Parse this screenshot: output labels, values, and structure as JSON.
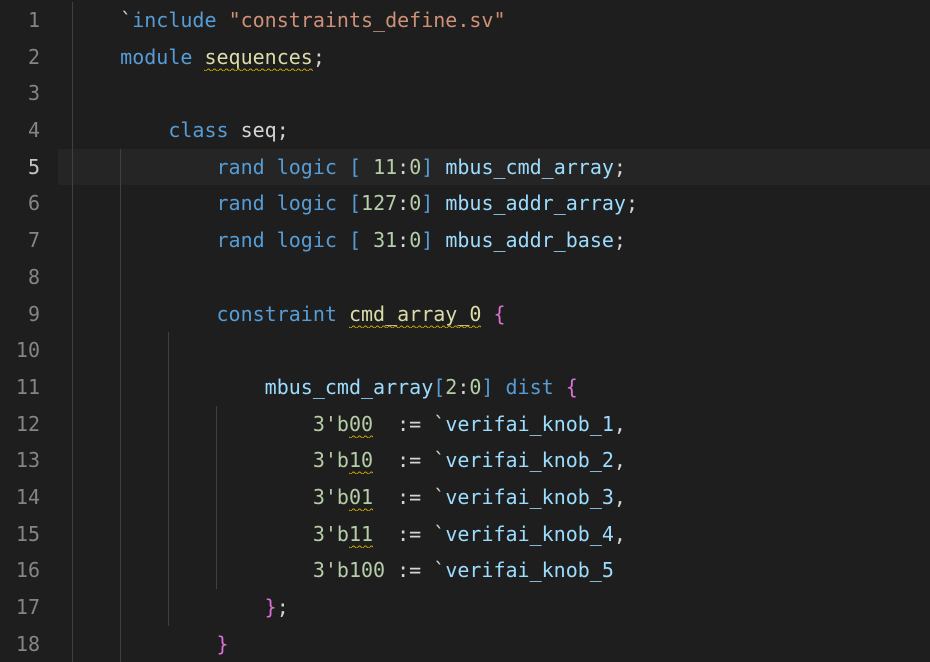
{
  "active_line": 5,
  "lines": [
    {
      "n": 1,
      "indent": 1,
      "guides": [
        1
      ],
      "tokens": [
        {
          "t": "`",
          "c": "tok-def"
        },
        {
          "t": "include",
          "c": "tok-kw"
        },
        {
          "t": " ",
          "c": ""
        },
        {
          "t": "\"constraints_define.sv\"",
          "c": "tok-str"
        }
      ]
    },
    {
      "n": 2,
      "indent": 1,
      "guides": [
        1
      ],
      "tokens": [
        {
          "t": "module",
          "c": "tok-kw"
        },
        {
          "t": " ",
          "c": ""
        },
        {
          "t": "sequences",
          "c": "tok-func squiggle"
        },
        {
          "t": ";",
          "c": "tok-punc"
        }
      ]
    },
    {
      "n": 3,
      "indent": 0,
      "guides": [
        1
      ],
      "tokens": []
    },
    {
      "n": 4,
      "indent": 2,
      "guides": [
        1
      ],
      "tokens": [
        {
          "t": "class",
          "c": "tok-kw"
        },
        {
          "t": " ",
          "c": ""
        },
        {
          "t": "seq",
          "c": "tok-def"
        },
        {
          "t": ";",
          "c": "tok-punc"
        }
      ]
    },
    {
      "n": 5,
      "indent": 3,
      "guides": [
        1,
        2
      ],
      "active": true,
      "tokens": [
        {
          "t": "rand",
          "c": "tok-kw"
        },
        {
          "t": " ",
          "c": ""
        },
        {
          "t": "logic",
          "c": "tok-type"
        },
        {
          "t": " ",
          "c": ""
        },
        {
          "t": "[",
          "c": "tok-brkt"
        },
        {
          "t": " 11",
          "c": "tok-num"
        },
        {
          "t": ":",
          "c": "tok-def"
        },
        {
          "t": "0",
          "c": "tok-num"
        },
        {
          "t": "]",
          "c": "tok-brkt"
        },
        {
          "t": " ",
          "c": ""
        },
        {
          "t": "mbus_cmd_array",
          "c": "tok-var"
        },
        {
          "t": ";",
          "c": "tok-punc"
        }
      ]
    },
    {
      "n": 6,
      "indent": 3,
      "guides": [
        1,
        2
      ],
      "tokens": [
        {
          "t": "rand",
          "c": "tok-kw"
        },
        {
          "t": " ",
          "c": ""
        },
        {
          "t": "logic",
          "c": "tok-type"
        },
        {
          "t": " ",
          "c": ""
        },
        {
          "t": "[",
          "c": "tok-brkt"
        },
        {
          "t": "127",
          "c": "tok-num"
        },
        {
          "t": ":",
          "c": "tok-def"
        },
        {
          "t": "0",
          "c": "tok-num"
        },
        {
          "t": "]",
          "c": "tok-brkt"
        },
        {
          "t": " ",
          "c": ""
        },
        {
          "t": "mbus_addr_array",
          "c": "tok-var"
        },
        {
          "t": ";",
          "c": "tok-punc"
        }
      ]
    },
    {
      "n": 7,
      "indent": 3,
      "guides": [
        1,
        2
      ],
      "tokens": [
        {
          "t": "rand",
          "c": "tok-kw"
        },
        {
          "t": " ",
          "c": ""
        },
        {
          "t": "logic",
          "c": "tok-type"
        },
        {
          "t": " ",
          "c": ""
        },
        {
          "t": "[",
          "c": "tok-brkt"
        },
        {
          "t": " 31",
          "c": "tok-num"
        },
        {
          "t": ":",
          "c": "tok-def"
        },
        {
          "t": "0",
          "c": "tok-num"
        },
        {
          "t": "]",
          "c": "tok-brkt"
        },
        {
          "t": " ",
          "c": ""
        },
        {
          "t": "mbus_addr_base",
          "c": "tok-var"
        },
        {
          "t": ";",
          "c": "tok-punc"
        }
      ]
    },
    {
      "n": 8,
      "indent": 0,
      "guides": [
        1,
        2
      ],
      "tokens": []
    },
    {
      "n": 9,
      "indent": 3,
      "guides": [
        1,
        2
      ],
      "tokens": [
        {
          "t": "constraint",
          "c": "tok-kw"
        },
        {
          "t": " ",
          "c": ""
        },
        {
          "t": "cmd_array_0",
          "c": "tok-func squiggle"
        },
        {
          "t": " ",
          "c": ""
        },
        {
          "t": "{",
          "c": "tok-paren"
        }
      ]
    },
    {
      "n": 10,
      "indent": 0,
      "guides": [
        1,
        2,
        3
      ],
      "tokens": []
    },
    {
      "n": 11,
      "indent": 4,
      "guides": [
        1,
        2,
        3
      ],
      "tokens": [
        {
          "t": "mbus_cmd_array",
          "c": "tok-var"
        },
        {
          "t": "[",
          "c": "tok-brkt"
        },
        {
          "t": "2",
          "c": "tok-num"
        },
        {
          "t": ":",
          "c": "tok-def"
        },
        {
          "t": "0",
          "c": "tok-num"
        },
        {
          "t": "]",
          "c": "tok-brkt"
        },
        {
          "t": " ",
          "c": ""
        },
        {
          "t": "dist",
          "c": "tok-kw"
        },
        {
          "t": " ",
          "c": ""
        },
        {
          "t": "{",
          "c": "tok-paren"
        }
      ]
    },
    {
      "n": 12,
      "indent": 5,
      "guides": [
        1,
        2,
        3,
        4
      ],
      "tokens": [
        {
          "t": "3'b",
          "c": "tok-num"
        },
        {
          "t": "00",
          "c": "tok-num squiggle"
        },
        {
          "t": "  ",
          "c": ""
        },
        {
          "t": ":=",
          "c": "tok-def"
        },
        {
          "t": " ",
          "c": ""
        },
        {
          "t": "`",
          "c": "tok-def"
        },
        {
          "t": "verifai_knob_1",
          "c": "tok-var"
        },
        {
          "t": ",",
          "c": "tok-punc"
        }
      ]
    },
    {
      "n": 13,
      "indent": 5,
      "guides": [
        1,
        2,
        3,
        4
      ],
      "tokens": [
        {
          "t": "3'b",
          "c": "tok-num"
        },
        {
          "t": "10",
          "c": "tok-num squiggle"
        },
        {
          "t": "  ",
          "c": ""
        },
        {
          "t": ":=",
          "c": "tok-def"
        },
        {
          "t": " ",
          "c": ""
        },
        {
          "t": "`",
          "c": "tok-def"
        },
        {
          "t": "verifai_knob_2",
          "c": "tok-var"
        },
        {
          "t": ",",
          "c": "tok-punc"
        }
      ]
    },
    {
      "n": 14,
      "indent": 5,
      "guides": [
        1,
        2,
        3,
        4
      ],
      "tokens": [
        {
          "t": "3'b",
          "c": "tok-num"
        },
        {
          "t": "01",
          "c": "tok-num squiggle"
        },
        {
          "t": "  ",
          "c": ""
        },
        {
          "t": ":=",
          "c": "tok-def"
        },
        {
          "t": " ",
          "c": ""
        },
        {
          "t": "`",
          "c": "tok-def"
        },
        {
          "t": "verifai_knob_3",
          "c": "tok-var"
        },
        {
          "t": ",",
          "c": "tok-punc"
        }
      ]
    },
    {
      "n": 15,
      "indent": 5,
      "guides": [
        1,
        2,
        3,
        4
      ],
      "tokens": [
        {
          "t": "3'b",
          "c": "tok-num"
        },
        {
          "t": "11",
          "c": "tok-num squiggle"
        },
        {
          "t": "  ",
          "c": ""
        },
        {
          "t": ":=",
          "c": "tok-def"
        },
        {
          "t": " ",
          "c": ""
        },
        {
          "t": "`",
          "c": "tok-def"
        },
        {
          "t": "verifai_knob_4",
          "c": "tok-var"
        },
        {
          "t": ",",
          "c": "tok-punc"
        }
      ]
    },
    {
      "n": 16,
      "indent": 5,
      "guides": [
        1,
        2,
        3,
        4
      ],
      "tokens": [
        {
          "t": "3'b100",
          "c": "tok-num"
        },
        {
          "t": " ",
          "c": ""
        },
        {
          "t": ":=",
          "c": "tok-def"
        },
        {
          "t": " ",
          "c": ""
        },
        {
          "t": "`",
          "c": "tok-def"
        },
        {
          "t": "verifai_knob_5",
          "c": "tok-var"
        }
      ]
    },
    {
      "n": 17,
      "indent": 4,
      "guides": [
        1,
        2,
        3
      ],
      "tokens": [
        {
          "t": "}",
          "c": "tok-paren"
        },
        {
          "t": ";",
          "c": "tok-punc"
        }
      ]
    },
    {
      "n": 18,
      "indent": 3,
      "guides": [
        1,
        2
      ],
      "tokens": [
        {
          "t": "}",
          "c": "tok-paren"
        }
      ]
    }
  ]
}
